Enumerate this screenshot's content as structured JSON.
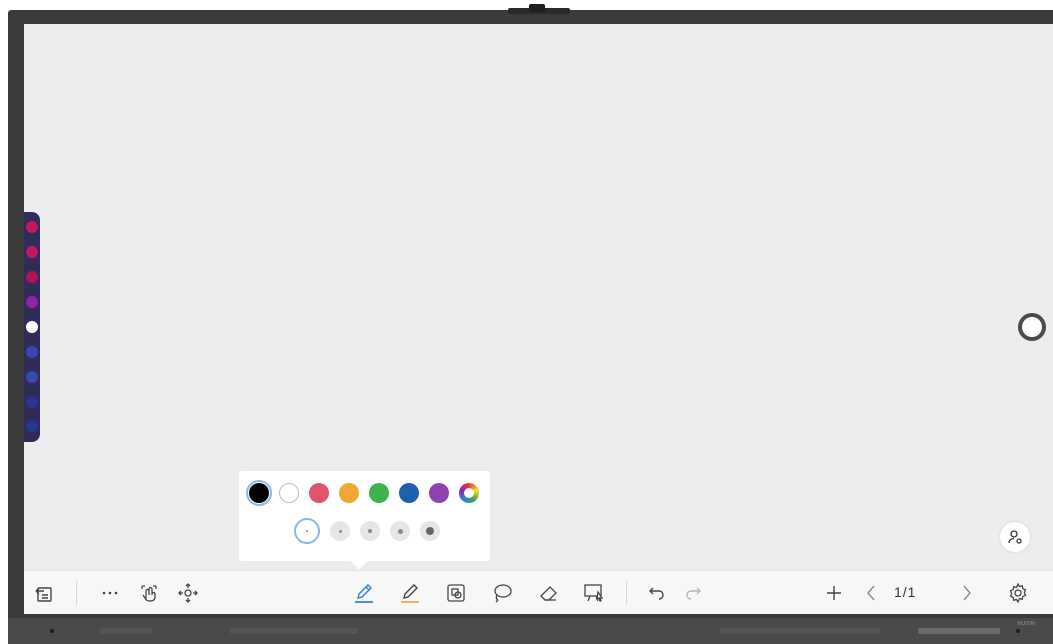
{
  "toolbar": {
    "page_indicator": "1/1"
  },
  "pen_popover": {
    "colors": [
      "#000000",
      "#ffffff",
      "#e05568",
      "#f0a830",
      "#3cb44a",
      "#1f5fb0",
      "#8e44ad",
      "color-wheel"
    ],
    "selected_color": "#000000",
    "size_options": 5,
    "selected_size_index": 0
  },
  "side_dock": {
    "button_colors": [
      "#c2185b",
      "#c2185b",
      "#ad1457",
      "#8e24aa",
      "#ffffff",
      "#3949ab",
      "#3949ab",
      "#283593",
      "#283593"
    ]
  },
  "accent_color": "#2f7ed8",
  "highlighter_underline_color": "#f0a830",
  "brand_text": "HUION"
}
